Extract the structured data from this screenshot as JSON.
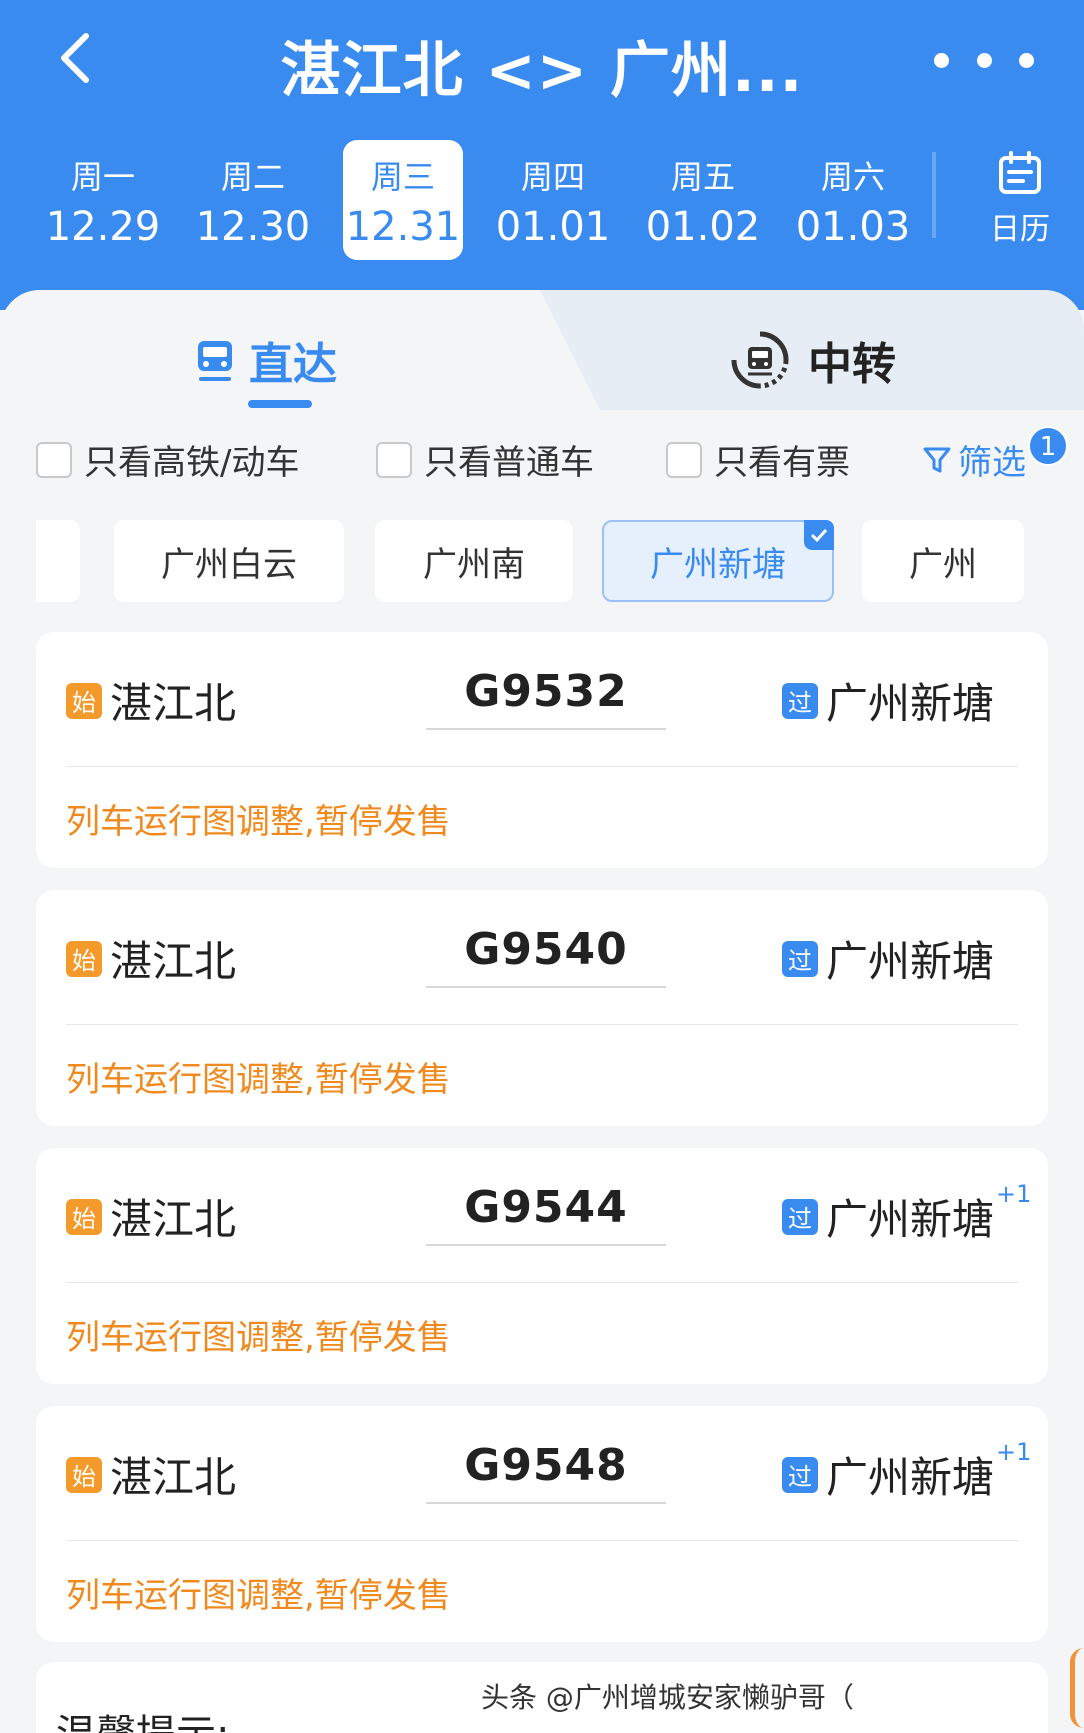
{
  "header": {
    "title": "湛江北 <> 广州...",
    "back_icon": "chevron-left-icon",
    "more_icon": "more-dots-icon"
  },
  "dates": [
    {
      "weekday": "周一",
      "date": "12.29",
      "active": false
    },
    {
      "weekday": "周二",
      "date": "12.30",
      "active": false
    },
    {
      "weekday": "周三",
      "date": "12.31",
      "active": true
    },
    {
      "weekday": "周四",
      "date": "01.01",
      "active": false
    },
    {
      "weekday": "周五",
      "date": "01.02",
      "active": false
    },
    {
      "weekday": "周六",
      "date": "01.03",
      "active": false
    }
  ],
  "calendar": {
    "label": "日历",
    "icon": "calendar-icon"
  },
  "tabs": {
    "direct": {
      "label": "直达",
      "icon": "train-icon",
      "active": true
    },
    "transfer": {
      "label": "中转",
      "icon": "transfer-train-icon",
      "active": false
    }
  },
  "filters": {
    "high_speed": "只看高铁/动车",
    "normal": "只看普通车",
    "available": "只看有票",
    "filter_label": "筛选",
    "filter_count": "1"
  },
  "stations": [
    {
      "name": "广州白云",
      "active": false
    },
    {
      "name": "广州南",
      "active": false
    },
    {
      "name": "广州新塘",
      "active": true
    },
    {
      "name": "广州",
      "active": false
    }
  ],
  "trains": [
    {
      "from_tag": "始",
      "from": "湛江北",
      "number": "G9532",
      "to_tag": "过",
      "to": "广州新塘",
      "plus": "",
      "status": "列车运行图调整,暂停发售"
    },
    {
      "from_tag": "始",
      "from": "湛江北",
      "number": "G9540",
      "to_tag": "过",
      "to": "广州新塘",
      "plus": "",
      "status": "列车运行图调整,暂停发售"
    },
    {
      "from_tag": "始",
      "from": "湛江北",
      "number": "G9544",
      "to_tag": "过",
      "to": "广州新塘",
      "plus": "+1",
      "status": "列车运行图调整,暂停发售"
    },
    {
      "from_tag": "始",
      "from": "湛江北",
      "number": "G9548",
      "to_tag": "过",
      "to": "广州新塘",
      "plus": "+1",
      "status": "列车运行图调整,暂停发售"
    }
  ],
  "tips": {
    "title": "温馨提示:"
  },
  "watermark": "头条 @广州增城安家懒驴哥（",
  "colors": {
    "primary": "#3a8bf0",
    "warning": "#f08a1f",
    "start_tag": "#f39a2b"
  }
}
